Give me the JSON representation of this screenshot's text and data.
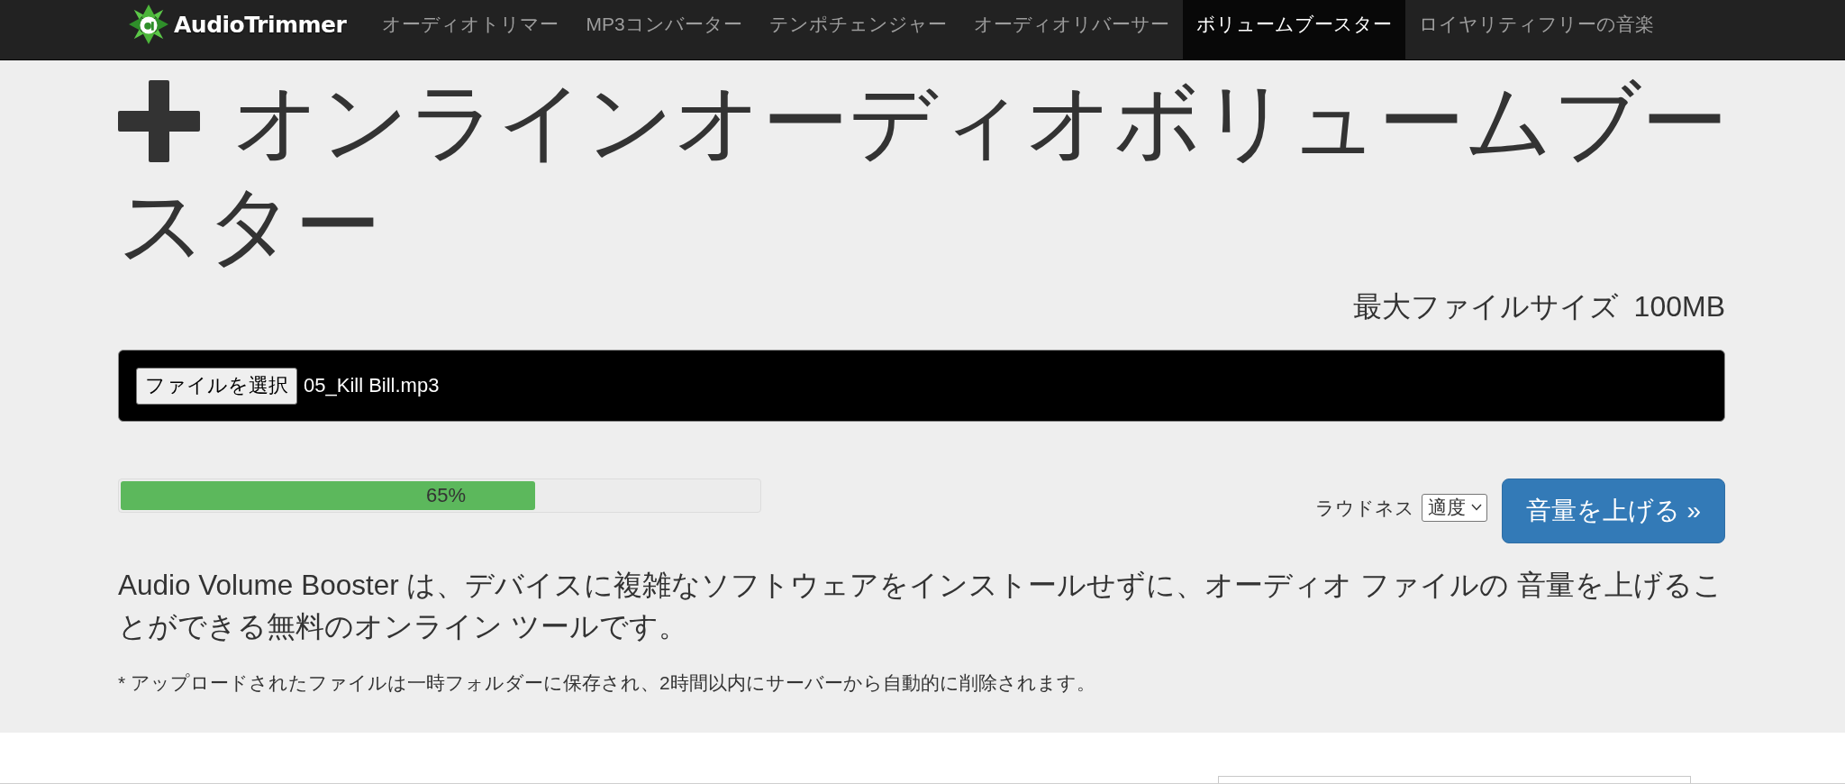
{
  "navbar": {
    "brand": "AudioTrimmer",
    "items": [
      {
        "label": "オーディオトリマー",
        "selected": false
      },
      {
        "label": "MP3コンバーター",
        "selected": false
      },
      {
        "label": "テンポチェンジャー",
        "selected": false
      },
      {
        "label": "オーディオリバーサー",
        "selected": false
      },
      {
        "label": "ボリュームブースター",
        "selected": true
      },
      {
        "label": "ロイヤリティフリーの音楽",
        "selected": false
      }
    ]
  },
  "page": {
    "title_lines": [
      "オンラインオーディオボリュームブー",
      "スター"
    ],
    "max_size": {
      "label": "最大ファイルサイズ",
      "value": "100MB"
    },
    "file_input": {
      "button": "ファイルを選択",
      "file_name": "05_Kill Bill.mp3"
    },
    "progress": {
      "level": 0.65,
      "label": "65%"
    },
    "loudness": {
      "label": "ラウドネス",
      "value": "適度"
    },
    "submit_button": "音量を上げる »",
    "description": "Audio Volume Booster は、デバイスに複雑なソフトウェアをインストールせずに、オーディオ ファイルの 音量を上げることができる無料のオンライン ツールです。",
    "note": "* アップロードされたファイルは一時フォルダーに保存され、2時間以内にサーバーから自動的に削除されます。"
  }
}
